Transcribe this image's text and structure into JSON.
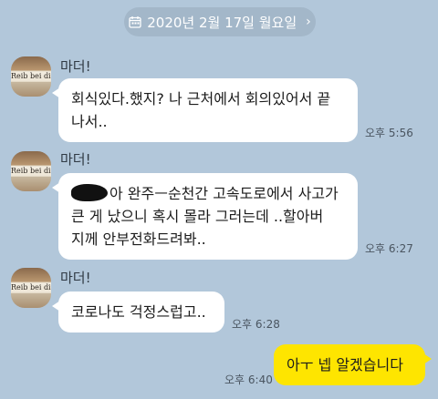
{
  "date_divider": {
    "text": "2020년 2월 17일 월요일",
    "icon": "calendar-icon",
    "chevron": "›"
  },
  "sender": {
    "name": "마더!",
    "avatar_text": "Reib bei dir"
  },
  "messages": [
    {
      "from": "other",
      "show_profile": true,
      "lines": [
        "회식있다.했지? 나 근처에서 회의있어서 끝",
        "나서.."
      ],
      "time": "오후 5:56"
    },
    {
      "from": "other",
      "show_profile": true,
      "redacted_prefix": true,
      "lines": [
        "아 완주ㅡ순천간 고속도로에서 사고가",
        "큰 게 났으니 혹시 몰라 그러는데 ..할아버",
        "지께 안부전화드려봐.."
      ],
      "time": "오후 6:27"
    },
    {
      "from": "other",
      "show_profile": true,
      "lines": [
        "코로나도 걱정스럽고.."
      ],
      "time": "오후 6:28"
    },
    {
      "from": "me",
      "lines": [
        "아ㅜ 넵 알겠습니다"
      ],
      "time": "오후 6:40"
    }
  ],
  "colors": {
    "background": "#b2c7da",
    "my_bubble": "#fee500",
    "other_bubble": "#ffffff"
  }
}
